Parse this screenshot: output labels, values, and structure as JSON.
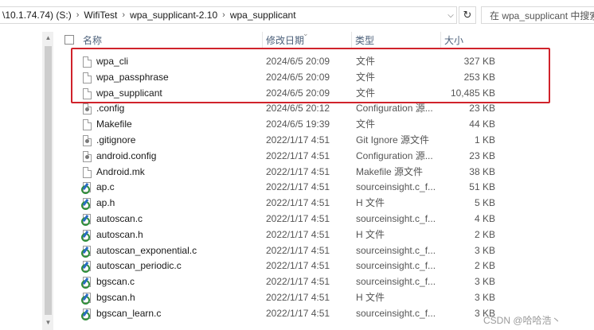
{
  "address": {
    "crumbs": [
      "\\10.1.74.74) (S:)",
      "WifiTest",
      "wpa_supplicant-2.10",
      "wpa_supplicant"
    ],
    "search_placeholder": "在 wpa_supplicant 中搜索"
  },
  "columns": {
    "name": "名称",
    "date": "修改日期",
    "type": "类型",
    "size": "大小"
  },
  "files": [
    {
      "name": "wpa_cli",
      "date": "2024/6/5 20:09",
      "type": "文件",
      "size": "327 KB",
      "icon": "file-icon"
    },
    {
      "name": "wpa_passphrase",
      "date": "2024/6/5 20:09",
      "type": "文件",
      "size": "253 KB",
      "icon": "file-icon"
    },
    {
      "name": "wpa_supplicant",
      "date": "2024/6/5 20:09",
      "type": "文件",
      "size": "10,485 KB",
      "icon": "file-icon"
    },
    {
      "name": ".config",
      "date": "2024/6/5 20:12",
      "type": "Configuration 源...",
      "size": "23 KB",
      "icon": "config-file-icon"
    },
    {
      "name": "Makefile",
      "date": "2024/6/5 19:39",
      "type": "文件",
      "size": "44 KB",
      "icon": "file-icon"
    },
    {
      "name": ".gitignore",
      "date": "2022/1/17 4:51",
      "type": "Git Ignore 源文件",
      "size": "1 KB",
      "icon": "config-file-icon"
    },
    {
      "name": "android.config",
      "date": "2022/1/17 4:51",
      "type": "Configuration 源...",
      "size": "23 KB",
      "icon": "config-file-icon"
    },
    {
      "name": "Android.mk",
      "date": "2022/1/17 4:51",
      "type": "Makefile 源文件",
      "size": "38 KB",
      "icon": "file-icon"
    },
    {
      "name": "ap.c",
      "date": "2022/1/17 4:51",
      "type": "sourceinsight.c_f...",
      "size": "51 KB",
      "icon": "sourceinsight-icon"
    },
    {
      "name": "ap.h",
      "date": "2022/1/17 4:51",
      "type": "H 文件",
      "size": "5 KB",
      "icon": "sourceinsight-icon"
    },
    {
      "name": "autoscan.c",
      "date": "2022/1/17 4:51",
      "type": "sourceinsight.c_f...",
      "size": "4 KB",
      "icon": "sourceinsight-icon"
    },
    {
      "name": "autoscan.h",
      "date": "2022/1/17 4:51",
      "type": "H 文件",
      "size": "2 KB",
      "icon": "sourceinsight-icon"
    },
    {
      "name": "autoscan_exponential.c",
      "date": "2022/1/17 4:51",
      "type": "sourceinsight.c_f...",
      "size": "3 KB",
      "icon": "sourceinsight-icon"
    },
    {
      "name": "autoscan_periodic.c",
      "date": "2022/1/17 4:51",
      "type": "sourceinsight.c_f...",
      "size": "2 KB",
      "icon": "sourceinsight-icon"
    },
    {
      "name": "bgscan.c",
      "date": "2022/1/17 4:51",
      "type": "sourceinsight.c_f...",
      "size": "3 KB",
      "icon": "sourceinsight-icon"
    },
    {
      "name": "bgscan.h",
      "date": "2022/1/17 4:51",
      "type": "H 文件",
      "size": "3 KB",
      "icon": "sourceinsight-icon"
    },
    {
      "name": "bgscan_learn.c",
      "date": "2022/1/17 4:51",
      "type": "sourceinsight.c_f...",
      "size": "3 KB",
      "icon": "sourceinsight-icon"
    }
  ],
  "watermark": "CSDN @哈哈浩丶",
  "colors": {
    "highlight": "#d0232b",
    "header_text": "#4c607a"
  }
}
